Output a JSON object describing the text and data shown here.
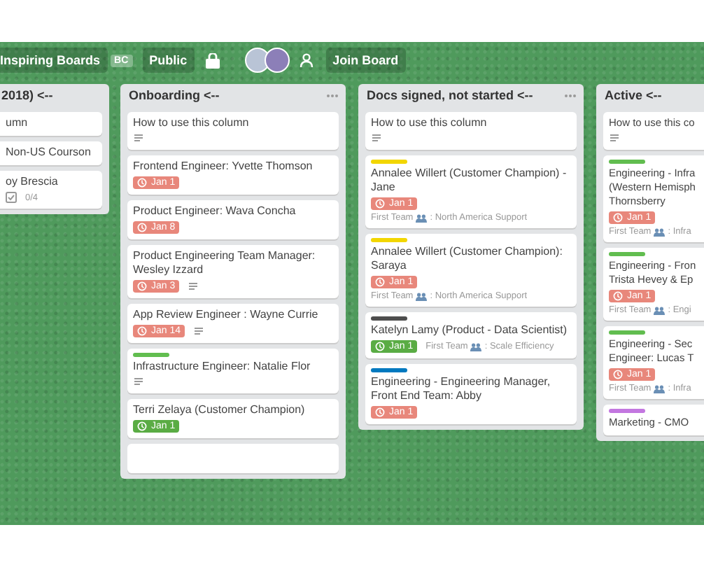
{
  "header": {
    "board_name": "Inspiring Boards",
    "board_badge": "BC",
    "visibility": "Public",
    "join": "Join Board"
  },
  "columns": [
    {
      "title": "2018) <--",
      "menu": false,
      "cards": [
        {
          "title": "umn",
          "comments": false
        },
        {
          "title": "Non-US Courson",
          "comments": false
        },
        {
          "title": "oy Brescia",
          "comments": false,
          "checklist": "0/4"
        }
      ]
    },
    {
      "title": "Onboarding <--",
      "menu": true,
      "cards": [
        {
          "title": "How to use this column",
          "comments": true
        },
        {
          "title": "Frontend Engineer: Yvette Thomson",
          "comments": false,
          "due": {
            "text": "Jan 1",
            "kind": "overdue"
          }
        },
        {
          "title": "Product Engineer: Wava Concha",
          "comments": false,
          "due": {
            "text": "Jan 8",
            "kind": "overdue"
          }
        },
        {
          "title": "Product Engineering Team Manager: Wesley Izzard",
          "comments": true,
          "due": {
            "text": "Jan 3",
            "kind": "overdue"
          }
        },
        {
          "title": "App Review Engineer : Wayne Currie",
          "comments": true,
          "due": {
            "text": "Jan 14",
            "kind": "overdue"
          }
        },
        {
          "title": "Infrastructure Engineer: Natalie Flor",
          "comments": true,
          "color": "#61bd4f"
        },
        {
          "title": "Terri Zelaya (Customer Champion)",
          "comments": false,
          "due": {
            "text": "Jan 1",
            "kind": "complete"
          }
        }
      ]
    },
    {
      "title": "Docs signed, not started <--",
      "menu": true,
      "cards": [
        {
          "title": "How to use this column",
          "comments": true
        },
        {
          "title": "Annalee Willert (Customer Champion) - Jane",
          "comments": false,
          "color": "#f2d600",
          "due": {
            "text": "Jan 1",
            "kind": "overdue"
          },
          "team": "First Team",
          "area": ": North America Support"
        },
        {
          "title": "Annalee Willert (Customer Champion): Saraya",
          "comments": false,
          "color": "#f2d600",
          "due": {
            "text": "Jan 1",
            "kind": "overdue"
          },
          "team": "First Team",
          "area": ": North America Support"
        },
        {
          "title": "Katelyn Lamy (Product - Data Scientist)",
          "comments": false,
          "color": "#4d4d4d",
          "due": {
            "text": "Jan 1",
            "kind": "complete"
          },
          "team": "First Team",
          "area": ": Scale Efficiency"
        },
        {
          "title": "Engineering - Engineering Manager, Front End Team: Abby",
          "comments": false,
          "color": "#0079bf",
          "due": {
            "text": "Jan 1",
            "kind": "overdue"
          }
        }
      ]
    },
    {
      "title": "Active <--",
      "menu": false,
      "cards": [
        {
          "title": "How to use this co",
          "comments": true
        },
        {
          "title": "Engineering - Infra (Western Hemisph Thornsberry",
          "comments": false,
          "color": "#61bd4f",
          "due": {
            "text": "Jan 1",
            "kind": "overdue"
          },
          "team": "First Team",
          "area": ": Infra"
        },
        {
          "title": "Engineering - Fron Trista Hevey & Ep",
          "comments": false,
          "color": "#61bd4f",
          "due": {
            "text": "Jan 1",
            "kind": "overdue"
          },
          "team": "First Team",
          "area": ": Engi"
        },
        {
          "title": "Engineering - Sec Engineer: Lucas T",
          "comments": false,
          "color": "#61bd4f",
          "due": {
            "text": "Jan 1",
            "kind": "overdue"
          },
          "team": "First Team",
          "area": ": Infra"
        },
        {
          "title": "Marketing - CMO",
          "comments": false,
          "color": "#c377e0"
        }
      ]
    }
  ]
}
